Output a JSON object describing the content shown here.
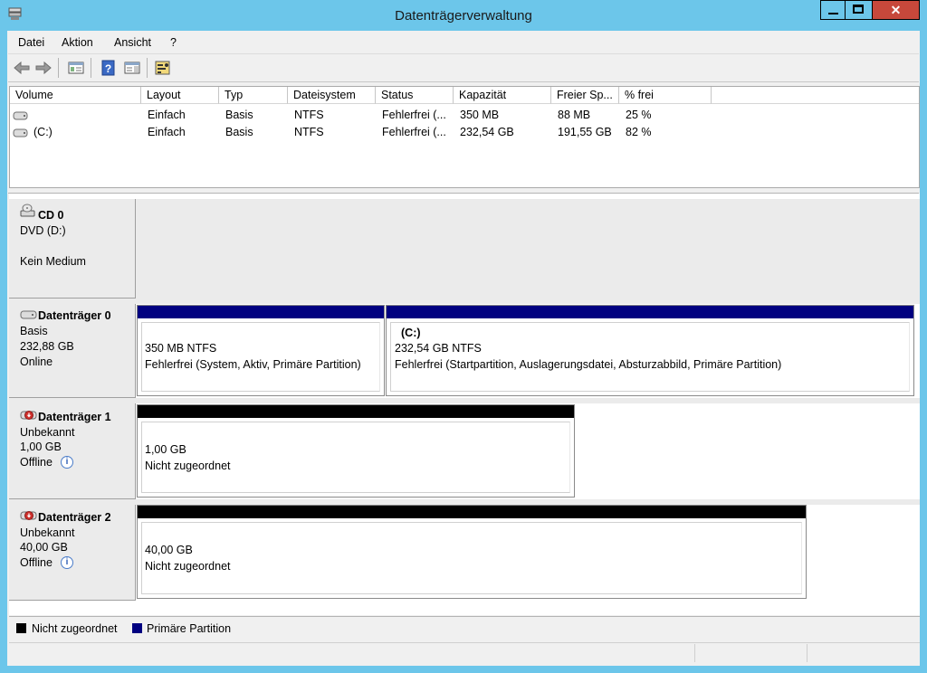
{
  "window": {
    "title": "Datenträgerverwaltung",
    "close_glyph": "✕"
  },
  "menu": [
    "Datei",
    "Aktion",
    "Ansicht",
    "?"
  ],
  "toolbar": {
    "icons": [
      "back-arrow-icon",
      "forward-arrow-icon",
      "console-tree-icon",
      "help-icon",
      "action-pane-icon",
      "properties-icon"
    ]
  },
  "volume_list": {
    "columns": [
      "Volume",
      "Layout",
      "Typ",
      "Dateisystem",
      "Status",
      "Kapazität",
      "Freier Sp...",
      "% frei"
    ],
    "rows": [
      [
        "",
        "Einfach",
        "Basis",
        "NTFS",
        "Fehlerfrei (...",
        "350 MB",
        "88 MB",
        "25 %"
      ],
      [
        "(C:)",
        "Einfach",
        "Basis",
        "NTFS",
        "Fehlerfrei (...",
        "232,54 GB",
        "191,55 GB",
        "82 %"
      ]
    ]
  },
  "disks": {
    "cd0": {
      "name": "CD 0",
      "line1": "DVD (D:)",
      "line2": "Kein Medium"
    },
    "disk0": {
      "name": "Datenträger 0",
      "type": "Basis",
      "size": "232,88 GB",
      "state": "Online",
      "partitions": [
        {
          "title": "",
          "size": "350 MB NTFS",
          "status": "Fehlerfrei (System, Aktiv, Primäre Partition)"
        },
        {
          "title": "(C:)",
          "size": "232,54 GB NTFS",
          "status": "Fehlerfrei (Startpartition, Auslagerungsdatei, Absturzabbild, Primäre Partition)"
        }
      ]
    },
    "disk1": {
      "name": "Datenträger 1",
      "type": "Unbekannt",
      "size": "1,00 GB",
      "state": "Offline",
      "partition": {
        "size": "1,00 GB",
        "status": "Nicht zugeordnet"
      }
    },
    "disk2": {
      "name": "Datenträger 2",
      "type": "Unbekannt",
      "size": "40,00 GB",
      "state": "Offline",
      "partition": {
        "size": "40,00 GB",
        "status": "Nicht zugeordnet"
      }
    }
  },
  "legend": [
    {
      "label": "Nicht zugeordnet",
      "color": "#000000"
    },
    {
      "label": "Primäre Partition",
      "color": "#000080"
    }
  ],
  "colors": {
    "titlebar": "#6cc6ea",
    "primary_partition": "#000080",
    "unallocated": "#000000",
    "close_button": "#c7483b"
  }
}
